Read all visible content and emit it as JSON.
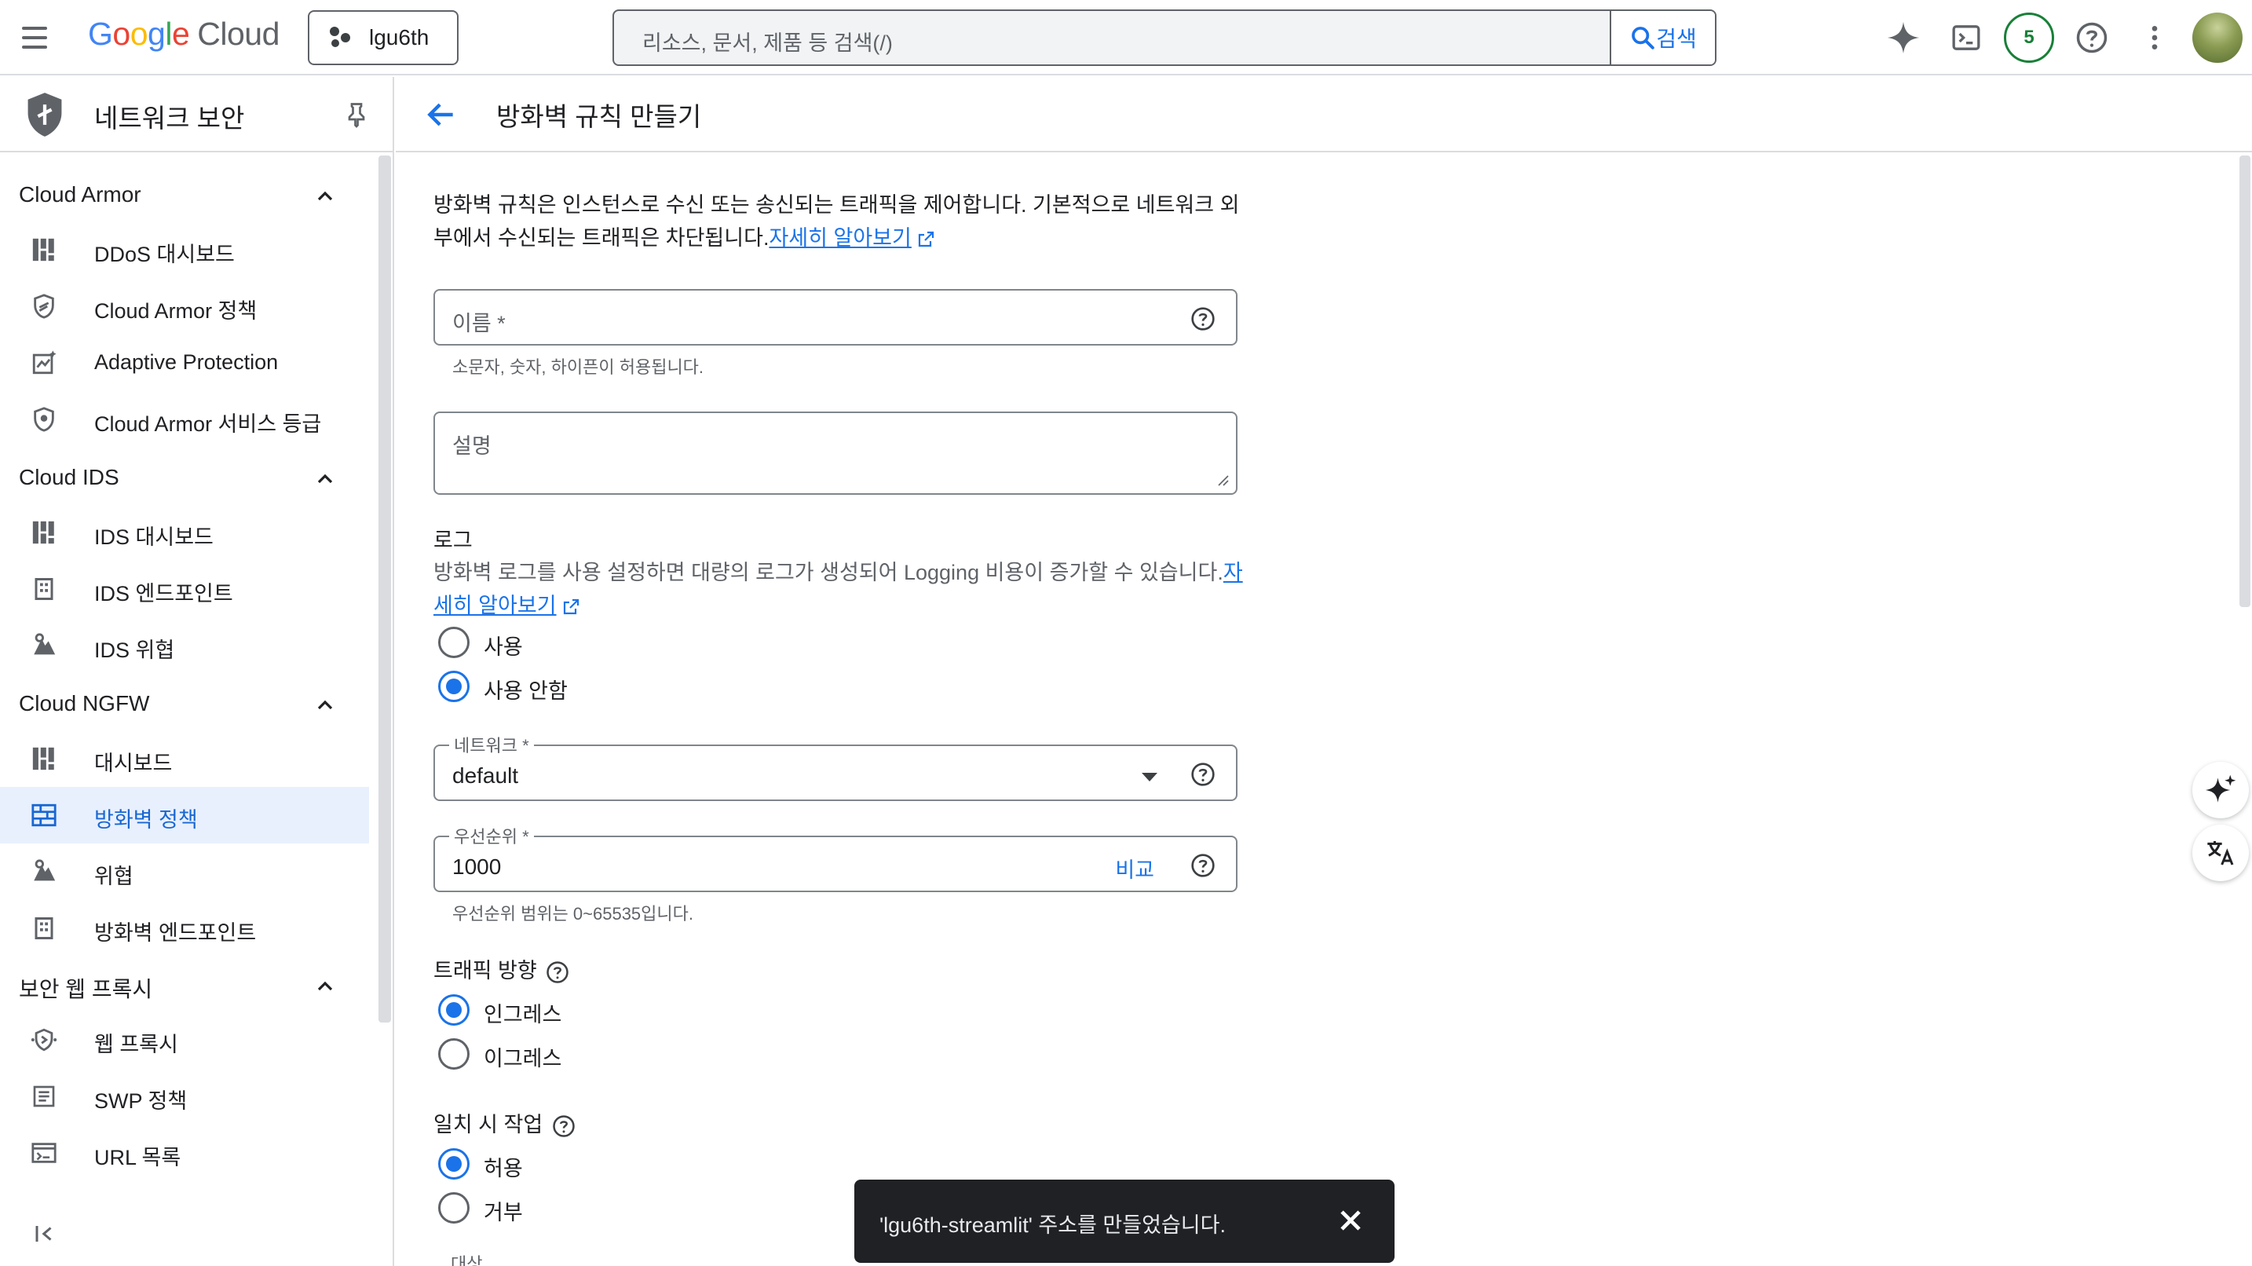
{
  "header": {
    "logo_google": "Google",
    "logo_cloud": "Cloud",
    "project": "lgu6th",
    "search_placeholder": "리소스, 문서, 제품 등 검색(/)",
    "search_button": "검색",
    "notification_count": "5"
  },
  "sidebar": {
    "title": "네트워크 보안",
    "sections": [
      {
        "title": "Cloud Armor",
        "items": [
          "DDoS 대시보드",
          "Cloud Armor 정책",
          "Adaptive Protection",
          "Cloud Armor 서비스 등급"
        ]
      },
      {
        "title": "Cloud IDS",
        "items": [
          "IDS 대시보드",
          "IDS 엔드포인트",
          "IDS 위협"
        ]
      },
      {
        "title": "Cloud NGFW",
        "items": [
          "대시보드",
          "방화벽 정책",
          "위협",
          "방화벽 엔드포인트"
        ]
      },
      {
        "title": "보안 웹 프록시",
        "items": [
          "웹 프록시",
          "SWP 정책",
          "URL 목록"
        ]
      }
    ],
    "active_item": "방화벽 정책",
    "collapse_label": "<I"
  },
  "page": {
    "title": "방화벽 규칙 만들기",
    "description": "방화벽 규칙은 인스턴스로 수신 또는 송신되는 트래픽을 제어합니다. 기본적으로 네트워크 외부에서 수신되는 트래픽은 차단됩니다.",
    "learn_more": "자세히 알아보기",
    "name_placeholder": "이름 *",
    "name_hint": "소문자, 숫자, 하이픈이 허용됩니다.",
    "description_placeholder": "설명",
    "logs_label": "로그",
    "logs_description": "방화벽 로그를 사용 설정하면 대량의 로그가 생성되어 Logging 비용이 증가할 수 있습니다.",
    "logs_learn_more": "자세히 알아보기",
    "logs_options": [
      "사용",
      "사용 안함"
    ],
    "logs_selected": "사용 안함",
    "network_label": "네트워크 *",
    "network_value": "default",
    "priority_label": "우선순위 *",
    "priority_value": "1000",
    "priority_compare": "비교",
    "priority_hint": "우선순위 범위는 0~65535입니다.",
    "direction_label": "트래픽 방향",
    "direction_options": [
      "인그레스",
      "이그레스"
    ],
    "direction_selected": "인그레스",
    "action_label": "일치 시 작업",
    "action_options": [
      "허용",
      "거부"
    ],
    "action_selected": "허용",
    "cutoff_label": "대상"
  },
  "toast": {
    "message": "'lgu6th-streamlit' 주소를 만들었습니다."
  },
  "colors": {
    "accent": "#1a73e8",
    "active_bg": "#e8f0fe",
    "toast_bg": "#202124",
    "badge_green": "#188038"
  }
}
